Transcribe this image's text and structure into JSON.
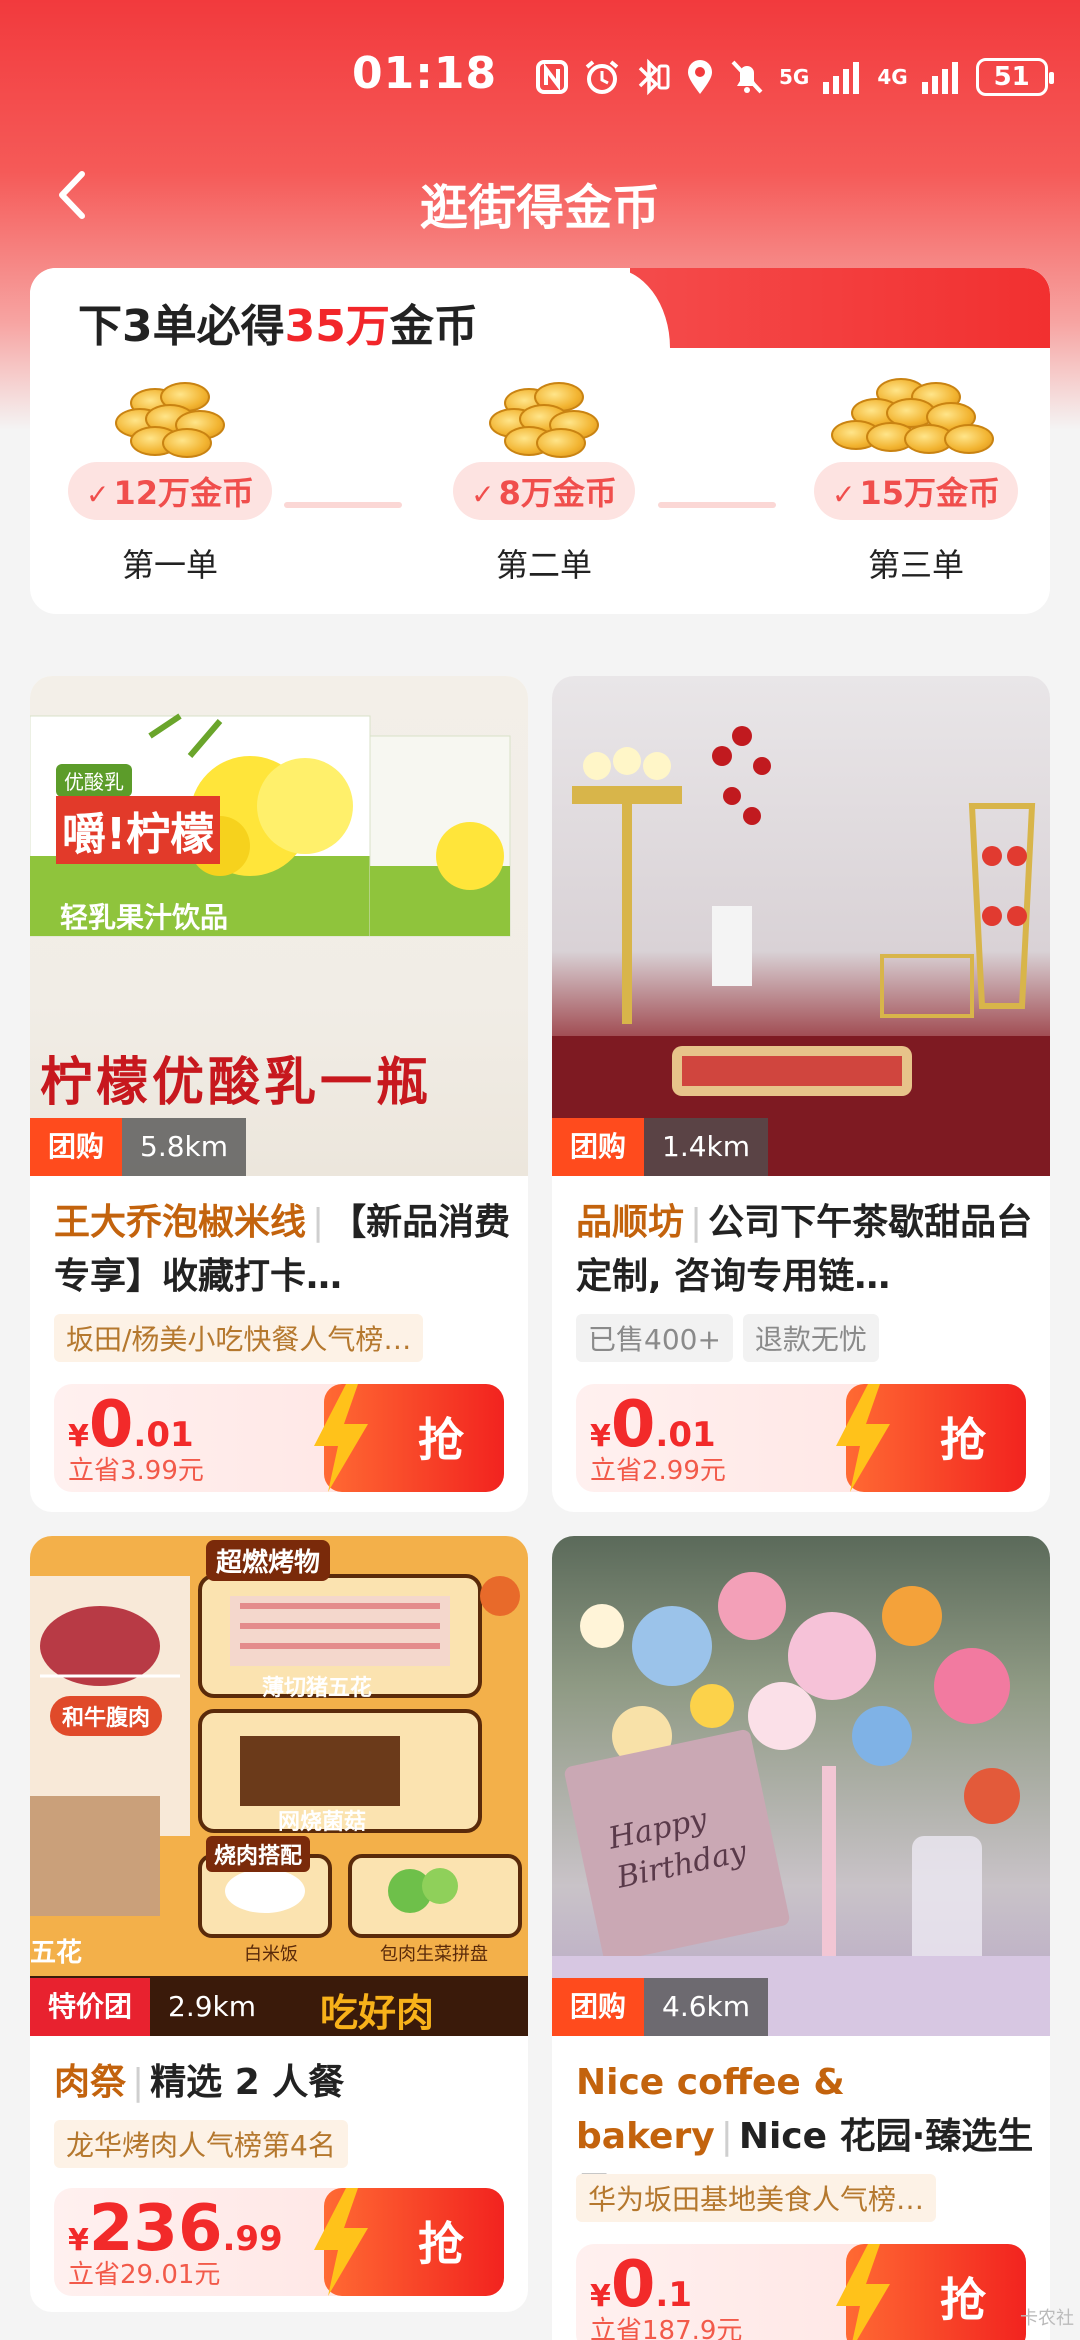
{
  "status_bar": {
    "time": "01:18",
    "net1": "5G",
    "net2": "4G",
    "battery": "51"
  },
  "header": {
    "title": "逛街得金币"
  },
  "coin_card": {
    "title_prefix": "下3单必得",
    "title_highlight": "35万",
    "title_suffix": "金币",
    "steps": [
      {
        "reward": "12万金币",
        "label": "第一单"
      },
      {
        "reward": "8万金币",
        "label": "第二单"
      },
      {
        "reward": "15万金币",
        "label": "第三单"
      }
    ]
  },
  "products": [
    {
      "type": "团购",
      "distance": "5.8km",
      "shop": "王大乔泡椒米线",
      "title": "【新品消费专享】收藏打卡…",
      "badges": [
        "坂田/杨美小吃快餐人气榜…"
      ],
      "currency": "¥",
      "price_int": "0",
      "price_dec": ".01",
      "saving": "立省3.99元",
      "grab": "抢",
      "image_text": {
        "brand": "优酸乳",
        "product": "嚼!柠檬",
        "sub": "轻乳果汁饮品",
        "banner": "柠檬优酸乳一瓶"
      }
    },
    {
      "type": "团购",
      "distance": "1.4km",
      "shop": "品顺坊",
      "title": "公司下午茶歇甜品台定制, 咨询专用链…",
      "badges": [
        "已售400+",
        "退款无忧"
      ],
      "currency": "¥",
      "price_int": "0",
      "price_dec": ".01",
      "saving": "立省2.99元",
      "grab": "抢"
    },
    {
      "type": "特价团",
      "distance": "2.9km",
      "shop": "肉祭",
      "title": "精选 2 人餐",
      "badges": [
        "龙华烤肉人气榜第4名"
      ],
      "currency": "¥",
      "price_int": "236",
      "price_dec": ".99",
      "saving": "立省29.01元",
      "grab": "抢",
      "image_text": {
        "top": "超燃烤物",
        "i1": "薄切猪五花",
        "i2": "和牛腹肉",
        "i3": "网烧菌菇",
        "mid": "烧肉搭配",
        "i4": "白米饭",
        "i5": "包肉生菜拼盘",
        "i6": "五花",
        "bottom": "吃好肉"
      }
    },
    {
      "type": "团购",
      "distance": "4.6km",
      "shop": "Nice coffee & bakery",
      "title": "Nice 花园·臻选生日/…",
      "badges": [
        "华为坂田基地美食人气榜…"
      ],
      "currency": "¥",
      "price_int": "0",
      "price_dec": ".1",
      "saving": "立省187.9元",
      "grab": "抢",
      "image_text": {
        "card": "Happy Birthday"
      }
    }
  ],
  "watermark": "卡农社"
}
